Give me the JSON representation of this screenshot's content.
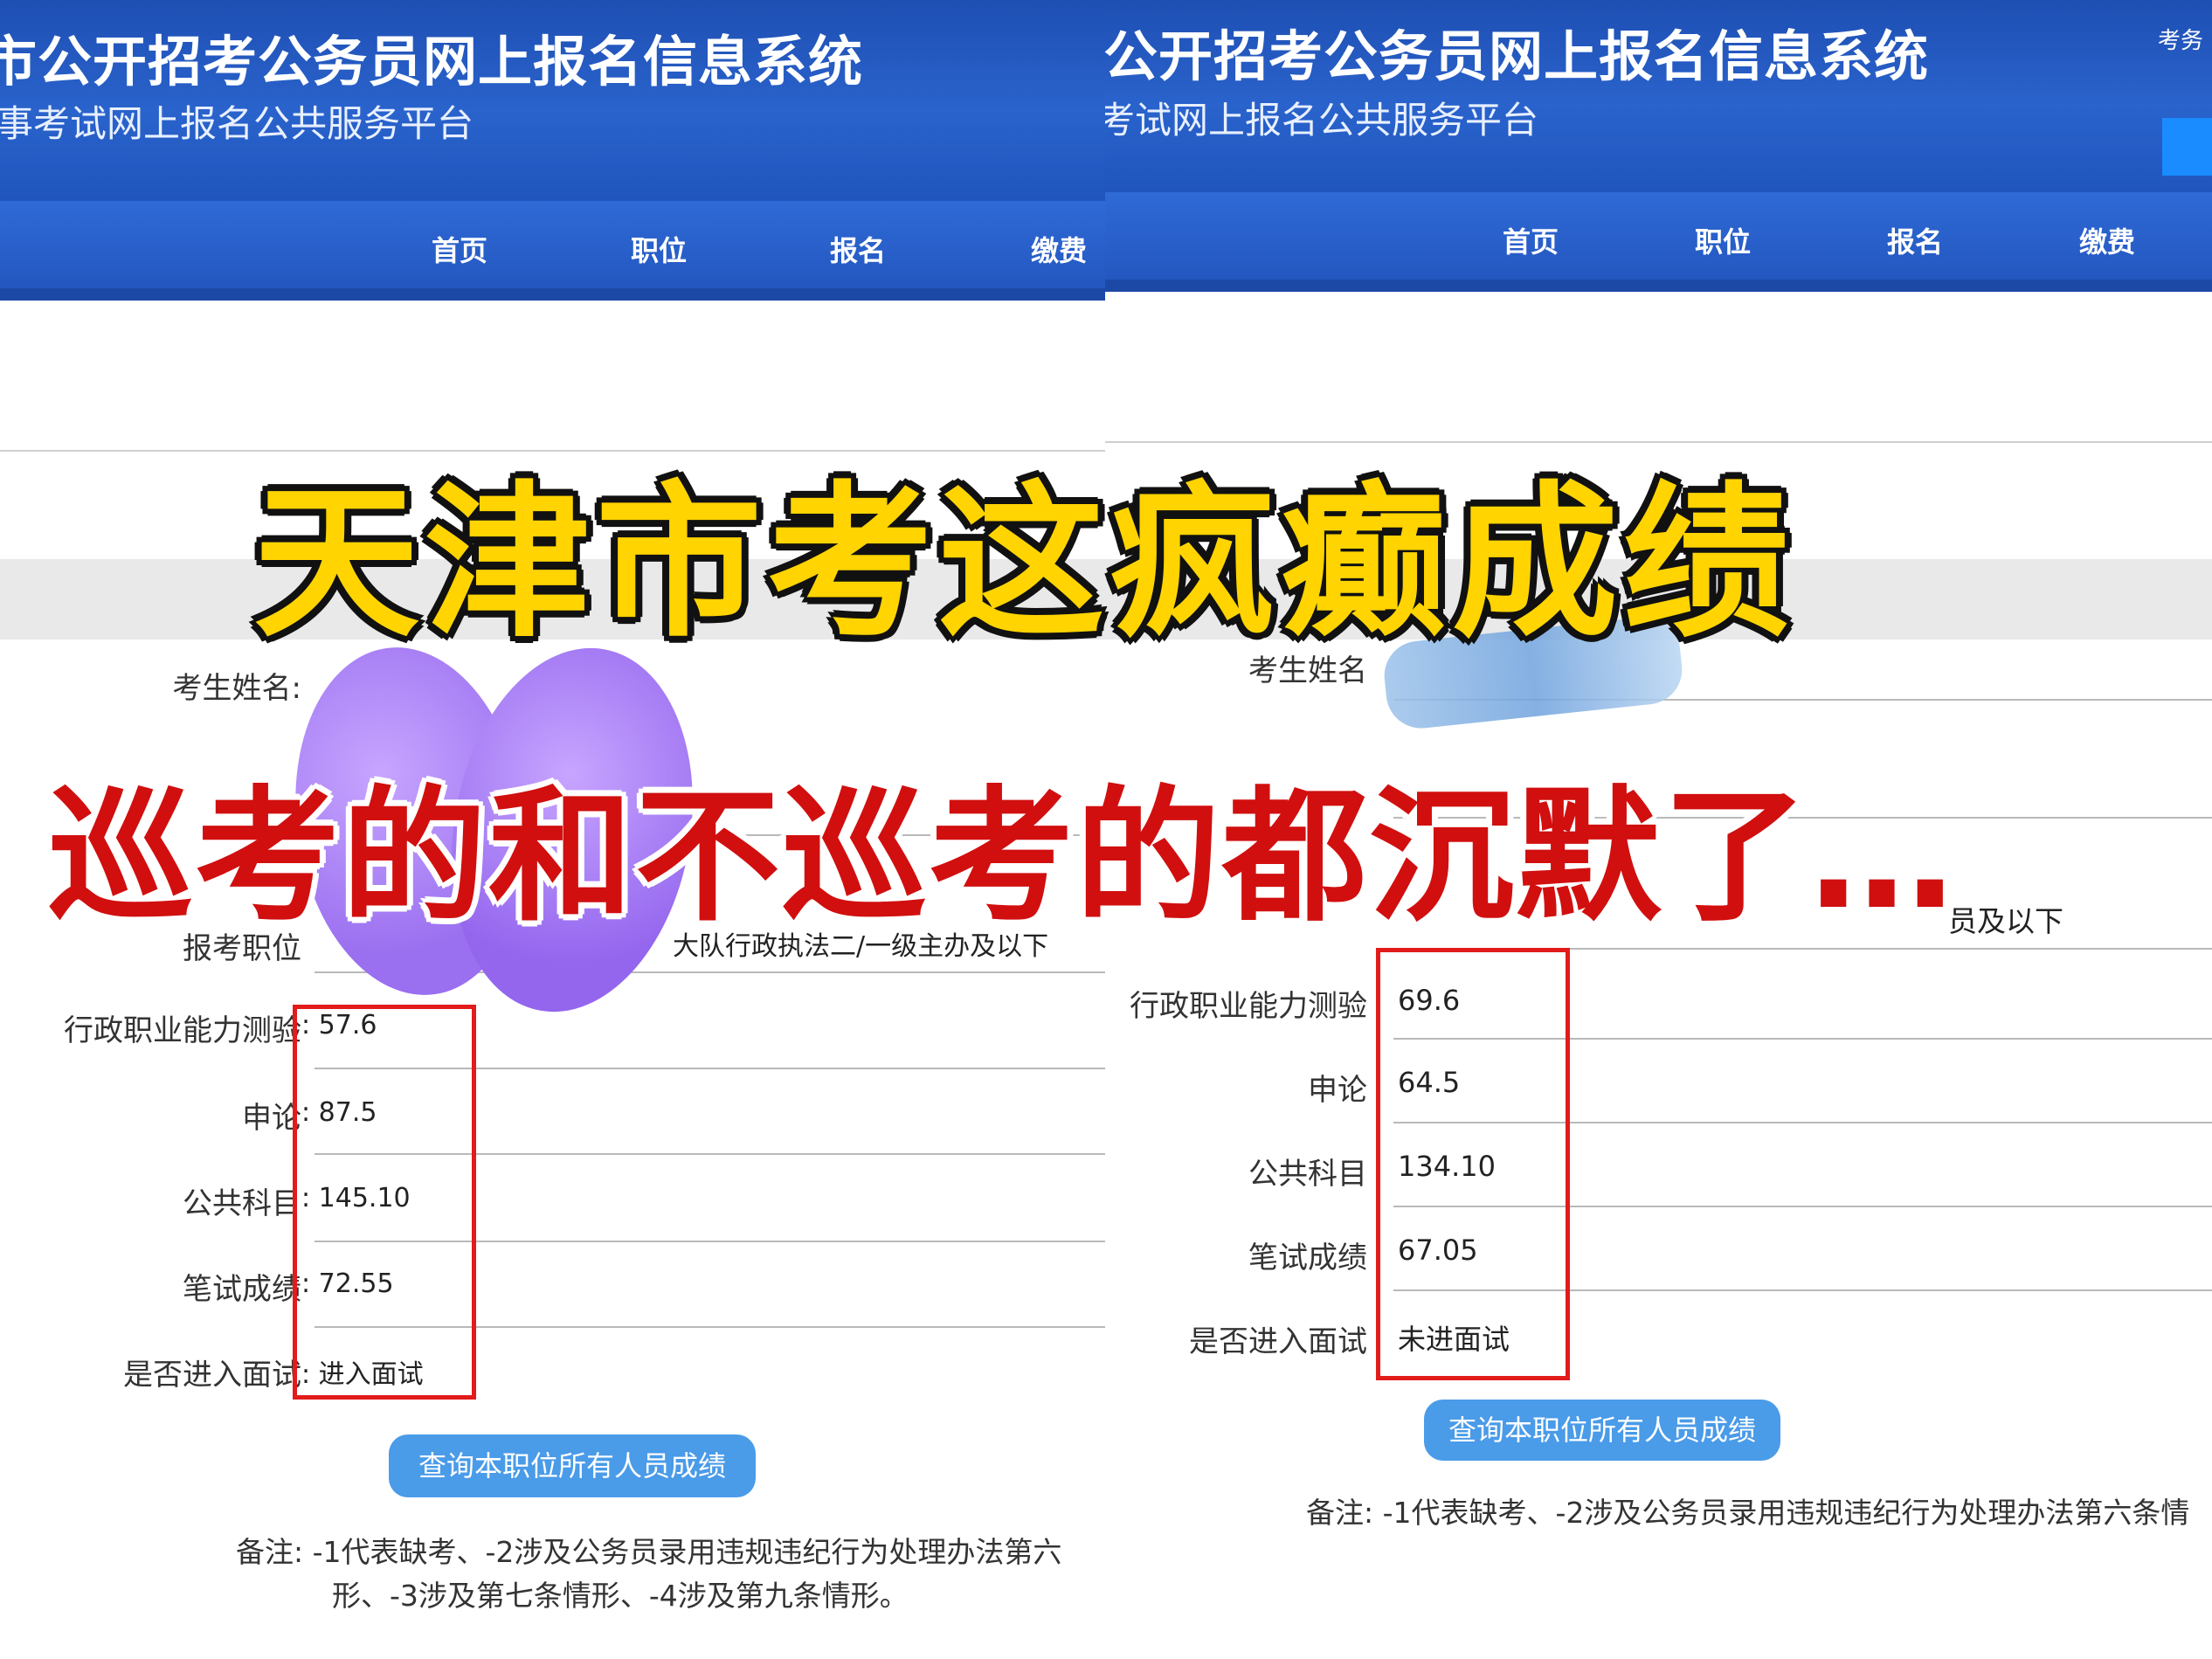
{
  "overlay": {
    "headline": "天津市考这疯癫成绩",
    "subheadline": "巡考的和不巡考的都沉默了…"
  },
  "colors": {
    "header_blue": "#1e4fb3",
    "headline_yellow": "#ffd400",
    "subheadline_red": "#d10f0f",
    "highlight_box": "#e21b1b",
    "button_blue": "#4a9be8"
  },
  "left": {
    "header": {
      "title": "市公开招考公务员网上报名信息系统",
      "subtitle": "事考试网上报名公共服务平台"
    },
    "nav": [
      "首页",
      "职位",
      "报名",
      "缴费"
    ],
    "fields": [
      {
        "label": "考生姓名:",
        "value": ""
      },
      {
        "label": "报考职位",
        "value": "大队行政执法二/一级主办及以下"
      },
      {
        "label": "行政职业能力测验",
        "value": ": 57.6"
      },
      {
        "label": "申论",
        "value": ": 87.5"
      },
      {
        "label": "公共科目",
        "value": ": 145.10"
      },
      {
        "label": "笔试成绩",
        "value": ": 72.55"
      },
      {
        "label": "是否进入面试",
        "value": ": 进入面试"
      }
    ],
    "query_button": "查询本职位所有人员成绩",
    "note_line1": "备注: -1代表缺考、-2涉及公务员录用违规违纪行为处理办法第六",
    "note_line2": "形、-3涉及第七条情形、-4涉及第九条情形。"
  },
  "right": {
    "header": {
      "title": "公开招考公务员网上报名信息系统",
      "subtitle": "考试网上报名公共服务平台",
      "corner_text": "考务"
    },
    "nav": [
      "首页",
      "职位",
      "报名",
      "缴费"
    ],
    "fields": [
      {
        "label": "考生姓名",
        "value": ""
      },
      {
        "label": "",
        "value": "员及以下"
      },
      {
        "label": "行政职业能力测验",
        "value": "69.6"
      },
      {
        "label": "申论",
        "value": "64.5"
      },
      {
        "label": "公共科目",
        "value": "134.10"
      },
      {
        "label": "笔试成绩",
        "value": "67.05"
      },
      {
        "label": "是否进入面试",
        "value": "未进面试"
      }
    ],
    "query_button": "查询本职位所有人员成绩",
    "note_line1": "备注: -1代表缺考、-2涉及公务员录用违规违纪行为处理办法第六条情"
  }
}
